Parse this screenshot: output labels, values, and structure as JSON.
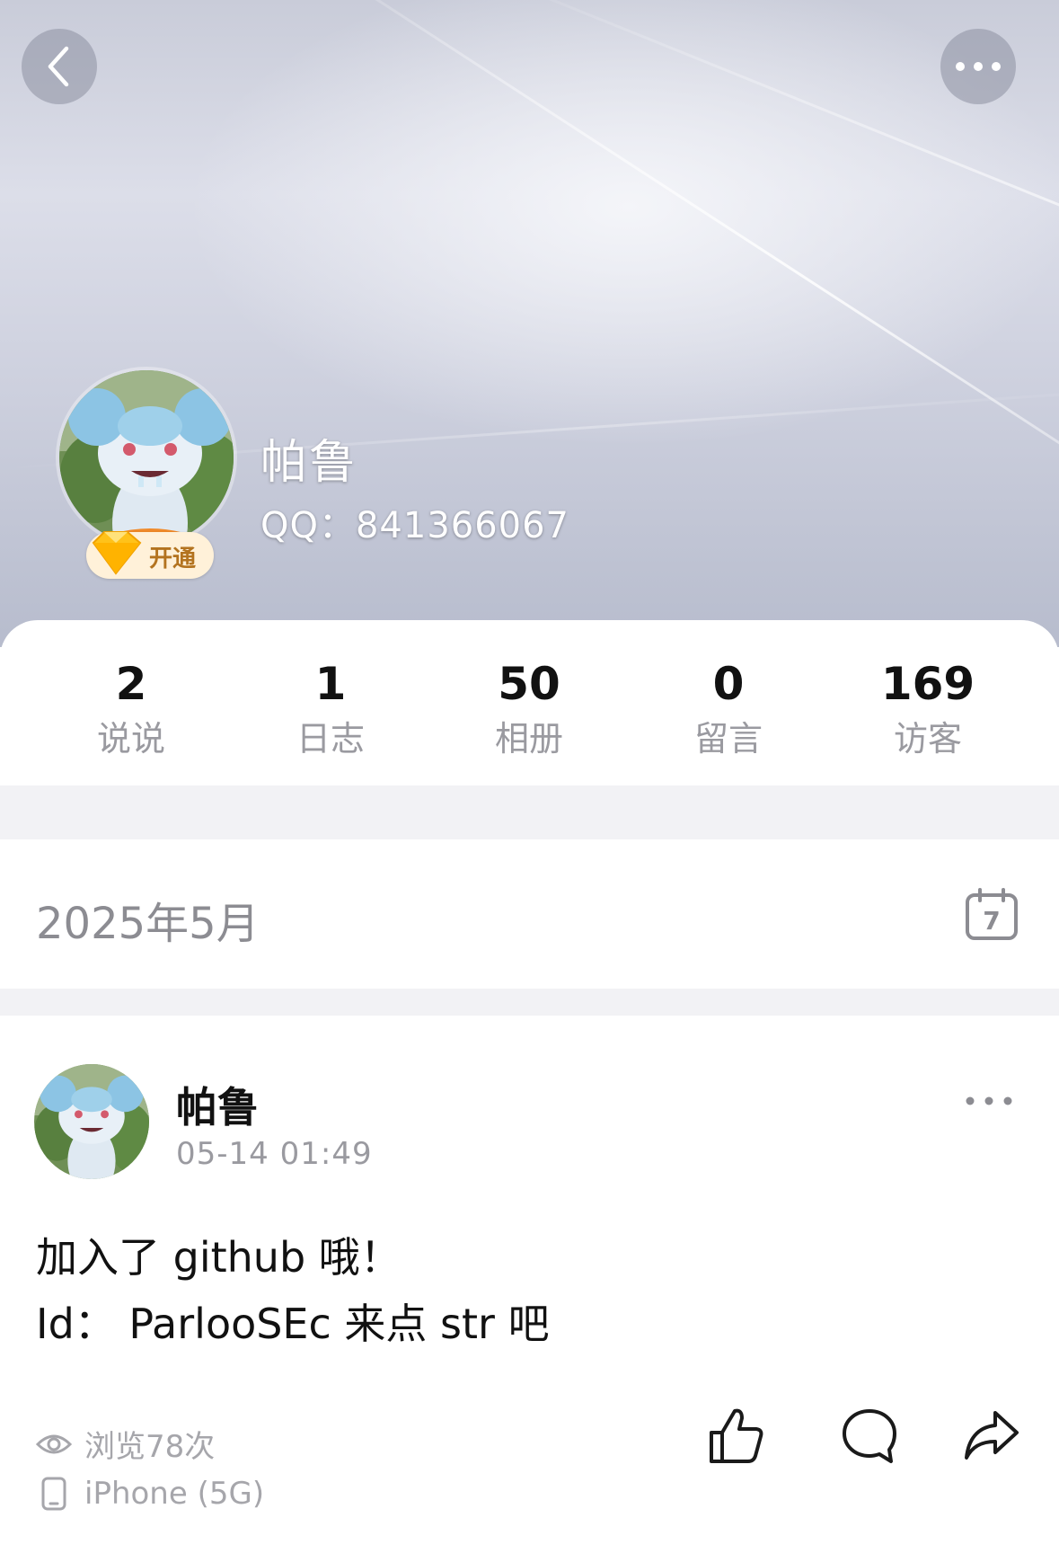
{
  "profile": {
    "name": "帕鲁",
    "qq_line": "QQ：841366067",
    "vip_label": "开通"
  },
  "stats": [
    {
      "value": "2",
      "label": "说说"
    },
    {
      "value": "1",
      "label": "日志"
    },
    {
      "value": "50",
      "label": "相册"
    },
    {
      "value": "0",
      "label": "留言"
    },
    {
      "value": "169",
      "label": "访客"
    }
  ],
  "timeline": {
    "month": "2025年5月",
    "calendar_day": "7"
  },
  "post": {
    "author": "帕鲁",
    "time": "05-14 01:49",
    "line1": "加入了 github 哦！",
    "line2": "Id：  ParlooSEc 来点 str 吧",
    "views": "浏览78次",
    "device": "iPhone (5G)"
  },
  "icons": {
    "back": "chevron-left-icon",
    "more": "more-dots-icon",
    "calendar": "calendar-icon",
    "like": "thumbs-up-icon",
    "comment": "comment-bubble-icon",
    "share": "share-arrow-icon",
    "views": "eye-icon",
    "device": "phone-icon"
  }
}
